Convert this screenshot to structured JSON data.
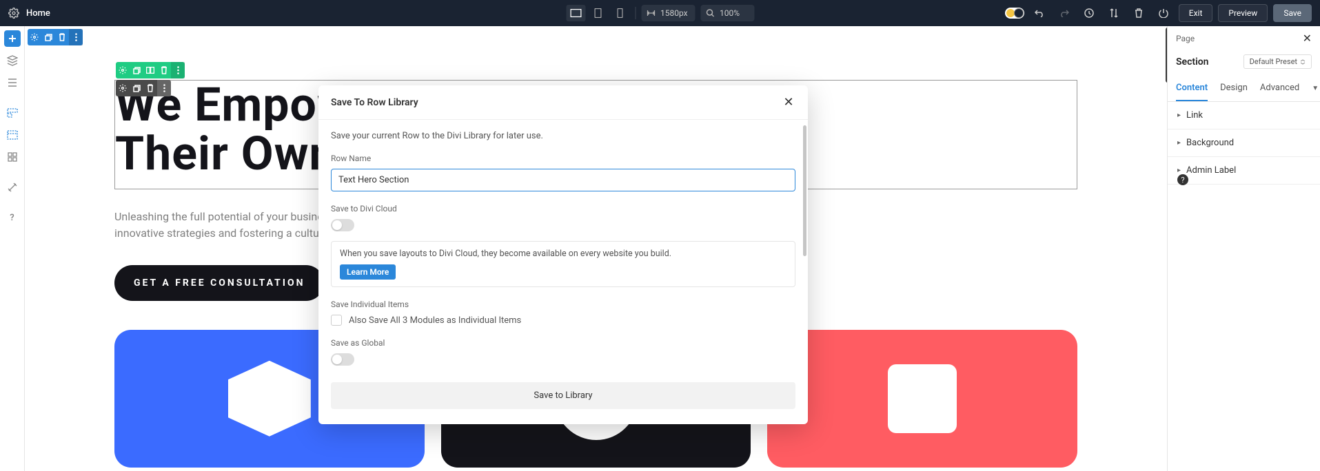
{
  "topbar": {
    "home": "Home",
    "width_value": "1580px",
    "zoom_value": "100%",
    "exit": "Exit",
    "preview": "Preview",
    "save": "Save"
  },
  "rightpanel": {
    "breadcrumb": "Page",
    "section_title": "Section",
    "preset_label": "Default Preset",
    "tabs": {
      "content": "Content",
      "design": "Design",
      "advanced": "Advanced"
    },
    "accordion": {
      "link": "Link",
      "background": "Background",
      "admin_label": "Admin Label"
    }
  },
  "hero": {
    "title_line1": "We Empow",
    "title_line2": "Their Own",
    "subtitle": "Unleashing the full potential of your busine\ninnovative strategies and fostering a cultur",
    "cta": "GET A FREE CONSULTATION"
  },
  "modal": {
    "title": "Save To Row Library",
    "description": "Save your current Row to the Divi Library for later use.",
    "row_name_label": "Row Name",
    "row_name_value": "Text Hero Section",
    "cloud_label": "Save to Divi Cloud",
    "cloud_info": "When you save layouts to Divi Cloud, they become available on every website you build.",
    "learn_more": "Learn More",
    "individual_label": "Save Individual Items",
    "individual_check": "Also Save All 3 Modules as Individual Items",
    "global_label": "Save as Global",
    "submit": "Save to Library"
  }
}
